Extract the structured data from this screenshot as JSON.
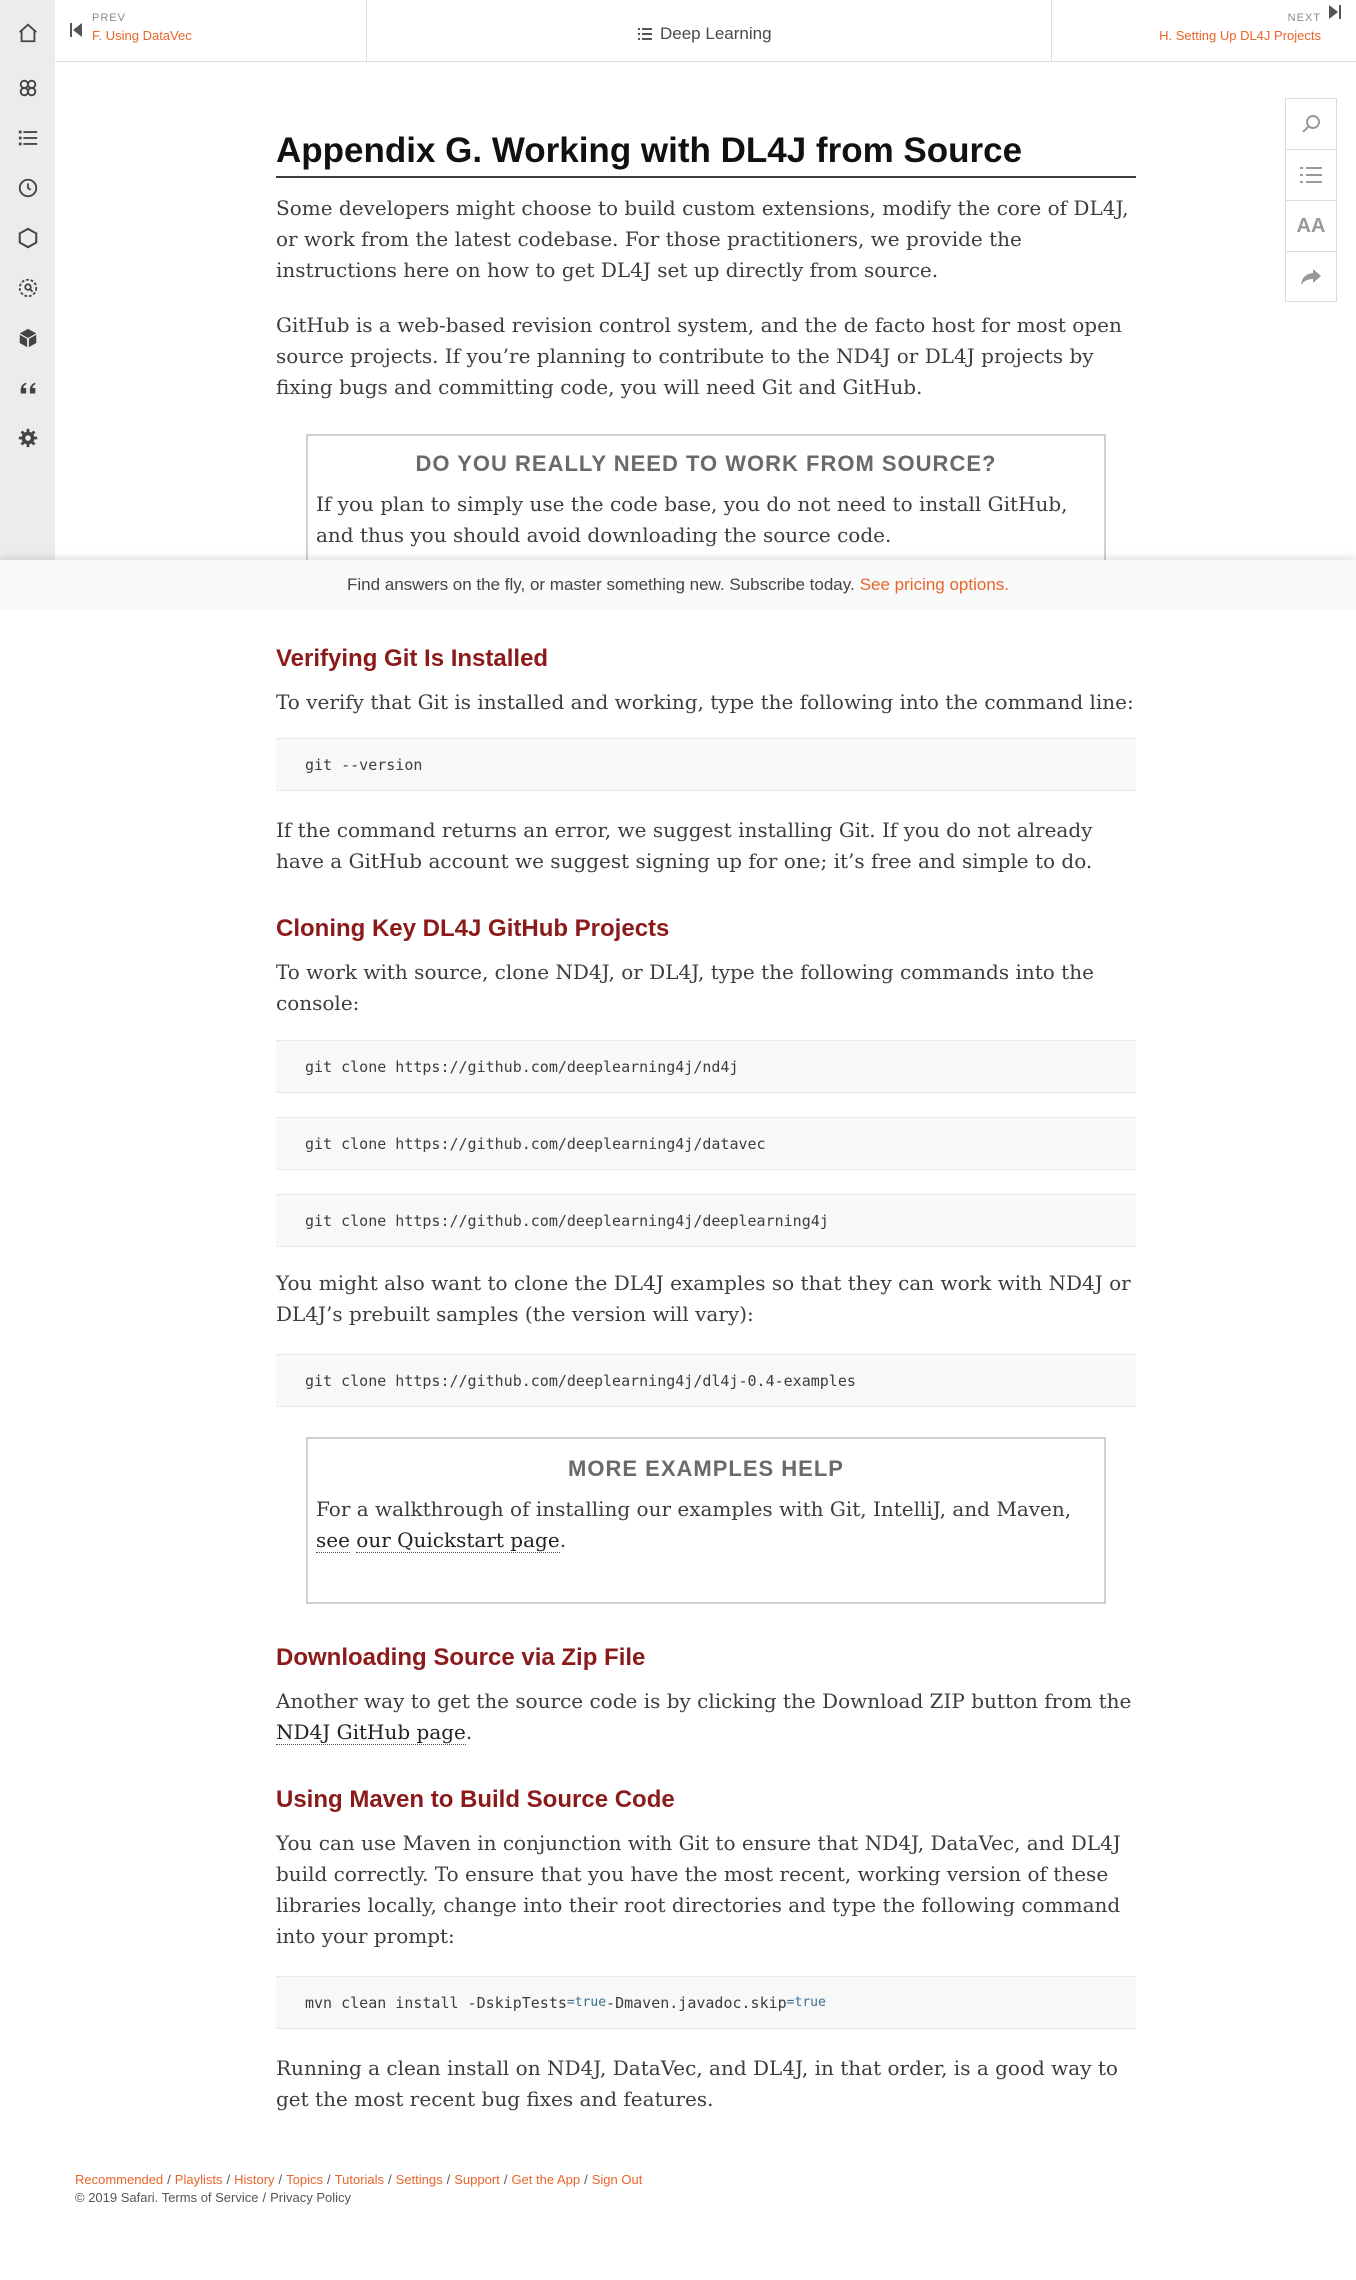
{
  "nav": {
    "prev_kicker": "PREV",
    "prev_title": "F. Using DataVec",
    "book_title": "Deep Learning",
    "next_kicker": "NEXT",
    "next_title": "H. Setting Up DL4J Projects"
  },
  "left_rail": [
    "home-icon",
    "topics-icon",
    "list-icon",
    "history-icon",
    "hexagon-icon",
    "search-icon",
    "cube-icon",
    "quote-icon",
    "gear-icon"
  ],
  "tools": [
    "search-icon",
    "toc-icon",
    "font-size-icon",
    "share-icon"
  ],
  "tools_labels": {
    "font": "AA"
  },
  "content": {
    "title": "Appendix G. Working with DL4J from Source",
    "p1": "Some developers might choose to build custom extensions, modify the core of DL4J, or work from the latest codebase. For those practitioners, we provide the instructions here on how to get DL4J set up directly from source.",
    "p2": "GitHub is a web-based revision control system, and the de facto host for most open source projects. If you’re planning to contribute to the ND4J or DL4J projects by fixing bugs and committing code, you will need Git and GitHub.",
    "sidebar1": {
      "title": "DO YOU REALLY NEED TO WORK FROM SOURCE?",
      "text": "If you plan to simply use the code base, you do not need to install GitHub, and thus you should avoid downloading the source code."
    },
    "h_verify": "Verifying Git Is Installed",
    "p_verify": "To verify that Git is installed and working, type the following into the command line:",
    "code_version": "git --version",
    "p_error": "If the command returns an error, we suggest installing Git. If you do not already have a GitHub account we suggest signing up for one; it’s free and simple to do.",
    "h_clone": "Cloning Key DL4J GitHub Projects",
    "p_clone": "To work with source, clone ND4J, or DL4J, type the following commands into the console:",
    "code_clone1": "git clone https://github.com/deeplearning4j/nd4j",
    "code_clone2": "git clone https://github.com/deeplearning4j/datavec",
    "code_clone3": "git clone https://github.com/deeplearning4j/deeplearning4j",
    "p_examples": "You might also want to clone the DL4J examples so that they can work with ND4J or DL4J’s prebuilt samples (the version will vary):",
    "code_examples": "git clone https://github.com/deeplearning4j/dl4j-0.4-examples",
    "sidebar2": {
      "title": "MORE EXAMPLES HELP",
      "text_before": "For a walkthrough of installing our examples with Git, IntelliJ, and Maven,",
      "link_part1": "see",
      "link_part2": "our Quickstart page",
      "text_after": "."
    },
    "h_zip": "Downloading Source via Zip File",
    "p_zip_before": "Another way to get the source code is by clicking the Download ZIP button from the",
    "p_zip_link": "ND4J GitHub page",
    "p_zip_after": ".",
    "h_maven": "Using Maven to Build Source Code",
    "p_maven": "You can use Maven in conjunction with Git to ensure that ND4J, DataVec, and DL4J build correctly. To ensure that you have the most recent, working version of these libraries lo­cally, change into their root directories and type the following command into your prompt:",
    "code_maven_a": "mvn clean install -DskipTests",
    "code_maven_eq1": "=true",
    "code_maven_b": " -Dmaven.javadoc.skip",
    "code_maven_eq2": "=true",
    "p_final": "Running a clean install on ND4J, DataVec, and DL4J, in that order, is a good way to get the most recent bug fixes and features."
  },
  "banner": {
    "text": "Find answers on the fly, or master something new. Subscribe today.",
    "link": "See pricing options."
  },
  "footer": {
    "links": [
      "Recommended",
      "Playlists",
      "History",
      "Topics",
      "Tutorials",
      "Settings",
      "Support",
      "Get the App",
      "Sign Out"
    ],
    "copyright": "© 2019 Safari.",
    "terms": "Terms of Service",
    "privacy": "Privacy Policy"
  }
}
